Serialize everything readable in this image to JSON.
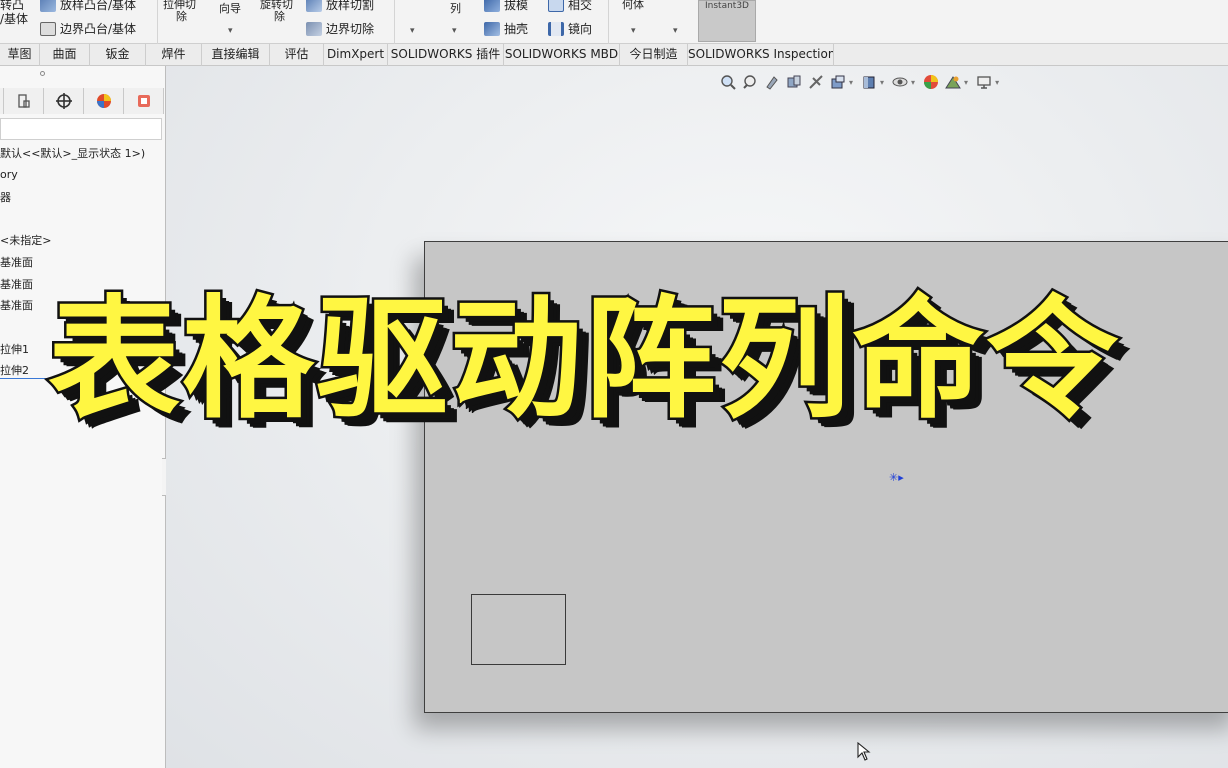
{
  "ribbon": {
    "items": [
      "转凸",
      "/基体",
      "放样凸台/基体",
      "边界凸台/基体",
      "拉伸切",
      "除",
      "向导",
      "旋转切",
      "除",
      "放样切割",
      "边界切除",
      "列",
      "拔模",
      "相交",
      "抽壳",
      "镜向",
      "何体"
    ],
    "instant3d_label": "Instant3D"
  },
  "tabs": [
    "草图",
    "曲面",
    "钣金",
    "焊件",
    "直接编辑",
    "评估",
    "DimXpert",
    "SOLIDWORKS 插件",
    "SOLIDWORKS MBD",
    "今日制造",
    "SOLIDWORKS Inspection"
  ],
  "tree": [
    "默认<<默认>_显示状态 1>)",
    "ory",
    "器",
    "<未指定>",
    "基准面",
    "基准面",
    "基准面",
    "拉伸1",
    "拉伸2"
  ],
  "overlay": {
    "title": "表格驱动阵列命令"
  },
  "colors": {
    "overlay_text": "#fff642",
    "overlay_outline": "#111111",
    "plate": "#c6c6c6",
    "origin": "#1f3fd6",
    "selection": "#3a78d6"
  },
  "icons": {
    "headsup": [
      "zoom-to-fit-icon",
      "zoom-area-icon",
      "previous-view-icon",
      "section-view-icon",
      "dynamic-annotation-icon",
      "view-orientation-icon",
      "display-style-icon",
      "hide-show-icon",
      "edit-appearance-icon",
      "apply-scene-icon",
      "view-settings-icon"
    ]
  }
}
